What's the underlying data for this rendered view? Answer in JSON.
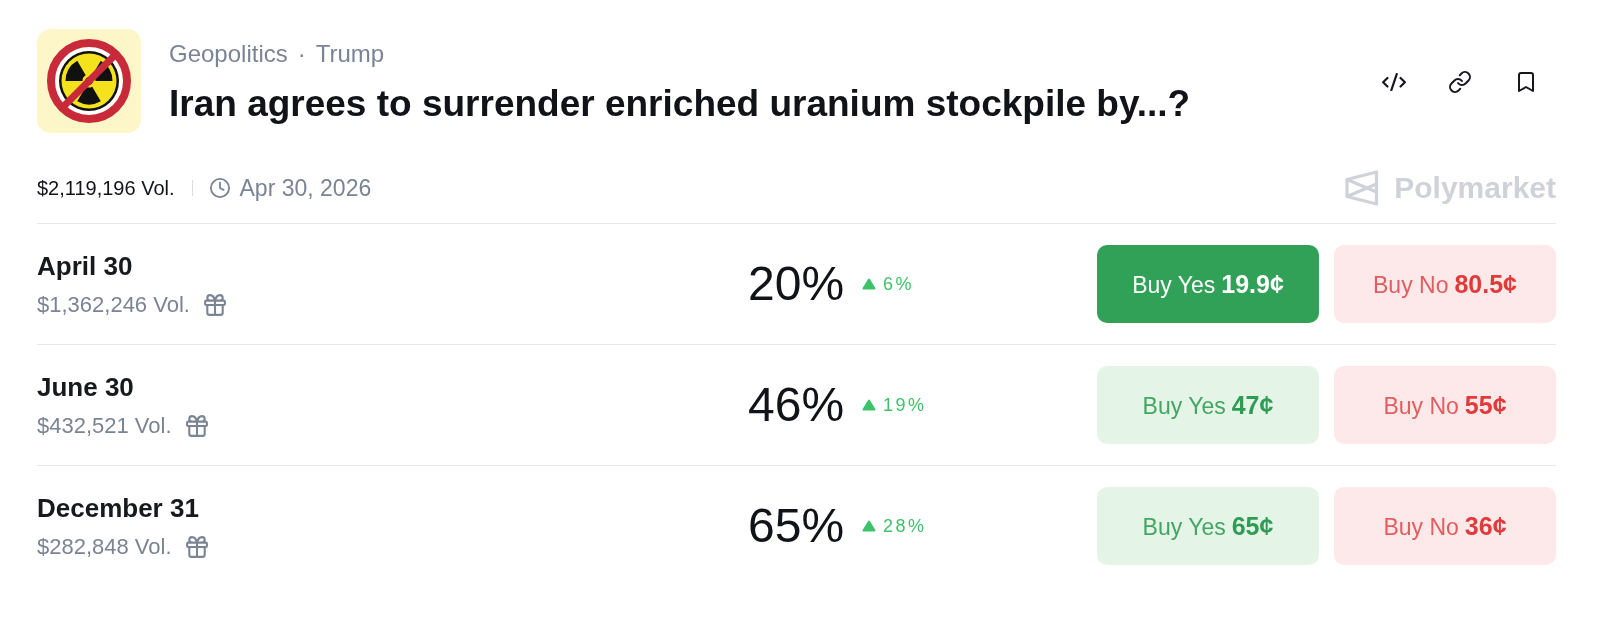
{
  "header": {
    "tags": [
      "Geopolitics",
      "Trump"
    ],
    "tag_separator": "·",
    "title": "Iran agrees to surrender enriched uranium stockpile by...?"
  },
  "meta": {
    "volume": "$2,119,196 Vol.",
    "end_date": "Apr 30, 2026"
  },
  "brand": {
    "name": "Polymarket"
  },
  "outcomes": [
    {
      "label": "April 30",
      "volume": "$1,362,246 Vol.",
      "chance": "20%",
      "rising": true,
      "change": "6%",
      "yes": {
        "label": "Buy Yes",
        "price": "19.9¢",
        "selected": true
      },
      "no": {
        "label": "Buy No",
        "price": "80.5¢",
        "selected": false
      }
    },
    {
      "label": "June 30",
      "volume": "$432,521 Vol.",
      "chance": "46%",
      "rising": true,
      "change": "19%",
      "yes": {
        "label": "Buy Yes",
        "price": "47¢",
        "selected": false
      },
      "no": {
        "label": "Buy No",
        "price": "55¢",
        "selected": false
      }
    },
    {
      "label": "December 31",
      "volume": "$282,848 Vol.",
      "chance": "65%",
      "rising": true,
      "change": "28%",
      "yes": {
        "label": "Buy Yes",
        "price": "65¢",
        "selected": false
      },
      "no": {
        "label": "Buy No",
        "price": "36¢",
        "selected": false
      }
    }
  ]
}
